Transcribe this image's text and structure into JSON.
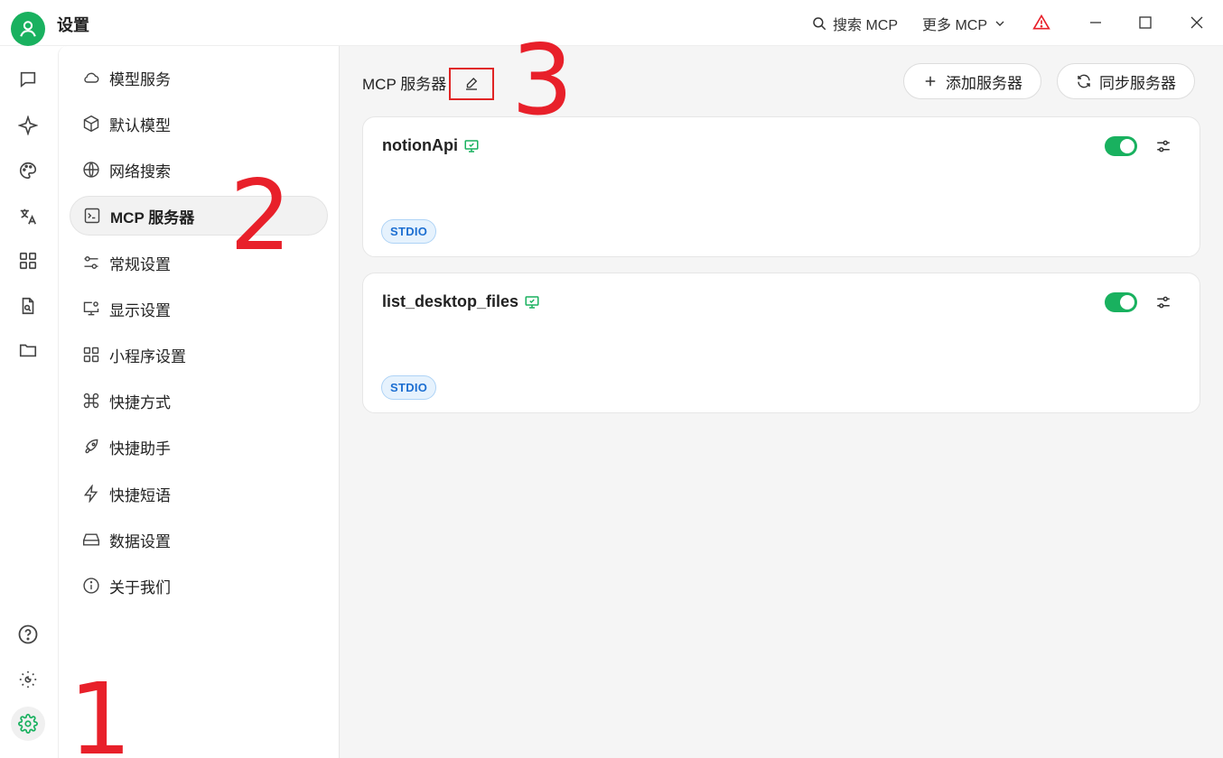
{
  "app": {
    "title": "设置"
  },
  "titlebar": {
    "search_mcp": "搜索 MCP",
    "more_mcp": "更多 MCP",
    "warning_color": "#e8202a"
  },
  "rail": {
    "items": [
      "chat-icon",
      "sparkle-icon",
      "palette-icon",
      "translate-icon",
      "apps-grid-icon",
      "document-search-icon",
      "folder-icon"
    ],
    "bottom": [
      "help-icon",
      "theme-icon",
      "settings-icon"
    ]
  },
  "sidebar": {
    "items": [
      {
        "label": "模型服务",
        "icon": "cloud-icon"
      },
      {
        "label": "默认模型",
        "icon": "cube-icon"
      },
      {
        "label": "网络搜索",
        "icon": "globe-icon"
      },
      {
        "label": "MCP 服务器",
        "icon": "terminal-icon",
        "active": true
      },
      {
        "label": "常规设置",
        "icon": "sliders-icon"
      },
      {
        "label": "显示设置",
        "icon": "monitor-gear-icon"
      },
      {
        "label": "小程序设置",
        "icon": "grid-icon"
      },
      {
        "label": "快捷方式",
        "icon": "command-icon"
      },
      {
        "label": "快捷助手",
        "icon": "rocket-icon"
      },
      {
        "label": "快捷短语",
        "icon": "zap-icon"
      },
      {
        "label": "数据设置",
        "icon": "drive-icon"
      },
      {
        "label": "关于我们",
        "icon": "info-icon"
      }
    ]
  },
  "main": {
    "title": "MCP 服务器",
    "add_button": "添加服务器",
    "sync_button": "同步服务器",
    "servers": [
      {
        "name": "notionApi",
        "type": "STDIO",
        "enabled": true
      },
      {
        "name": "list_desktop_files",
        "type": "STDIO",
        "enabled": true
      }
    ]
  },
  "annotations": [
    "1",
    "2",
    "3"
  ],
  "colors": {
    "accent": "#19b15f",
    "annotation": "#e8202a",
    "badge_text": "#1d6fd1"
  }
}
